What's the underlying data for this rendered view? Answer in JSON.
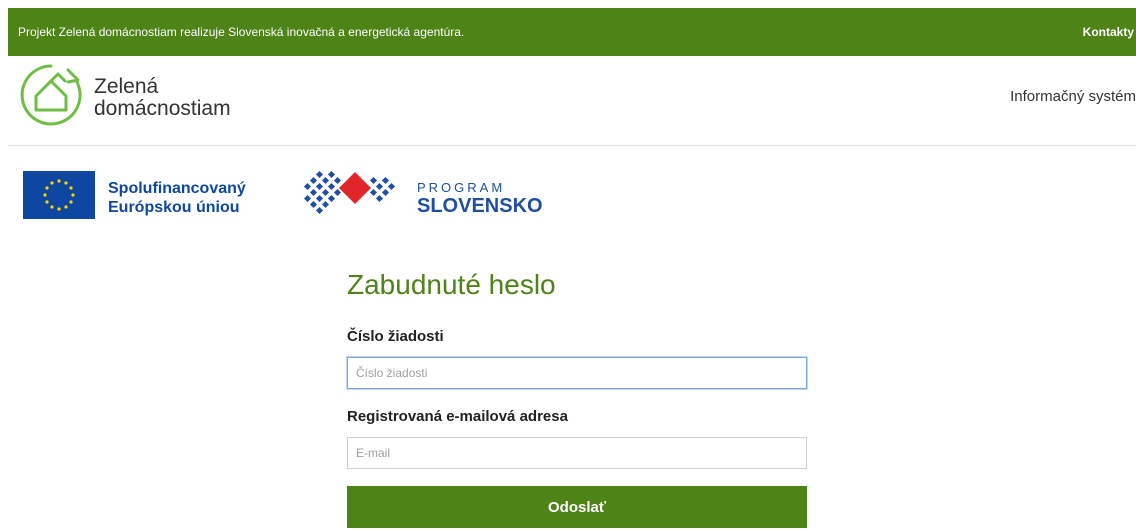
{
  "topbar": {
    "text": "Projekt Zelená domácnostiam realizuje Slovenská inovačná a energetická agentúra.",
    "contacts_label": "Kontakty"
  },
  "header": {
    "logo_line1": "Zelená",
    "logo_line2": "domácnostiam",
    "logo_icon": "green-house-circle-arrow-icon",
    "infosys_label": "Informačný systém"
  },
  "sponsors": {
    "eu_line1": "Spolufinancovaný",
    "eu_line2": "Európskou úniou",
    "eu_icon": "eu-flag-icon",
    "program_small": "PROGRAM",
    "program_big": "SLOVENSKO",
    "program_icon": "program-slovensko-logo-icon"
  },
  "form": {
    "title": "Zabudnuté heslo",
    "field1": {
      "label": "Číslo žiadosti",
      "placeholder": "Číslo žiadosti",
      "value": ""
    },
    "field2": {
      "label": "Registrovaná e-mailová adresa",
      "placeholder": "E-mail",
      "value": ""
    },
    "submit_label": "Odoslať"
  },
  "colors": {
    "brand_green": "#4d8317",
    "logo_green": "#6fbe44",
    "eu_blue": "#0e47a1",
    "program_blue": "#1e4fa3",
    "program_red": "#e0252b"
  }
}
